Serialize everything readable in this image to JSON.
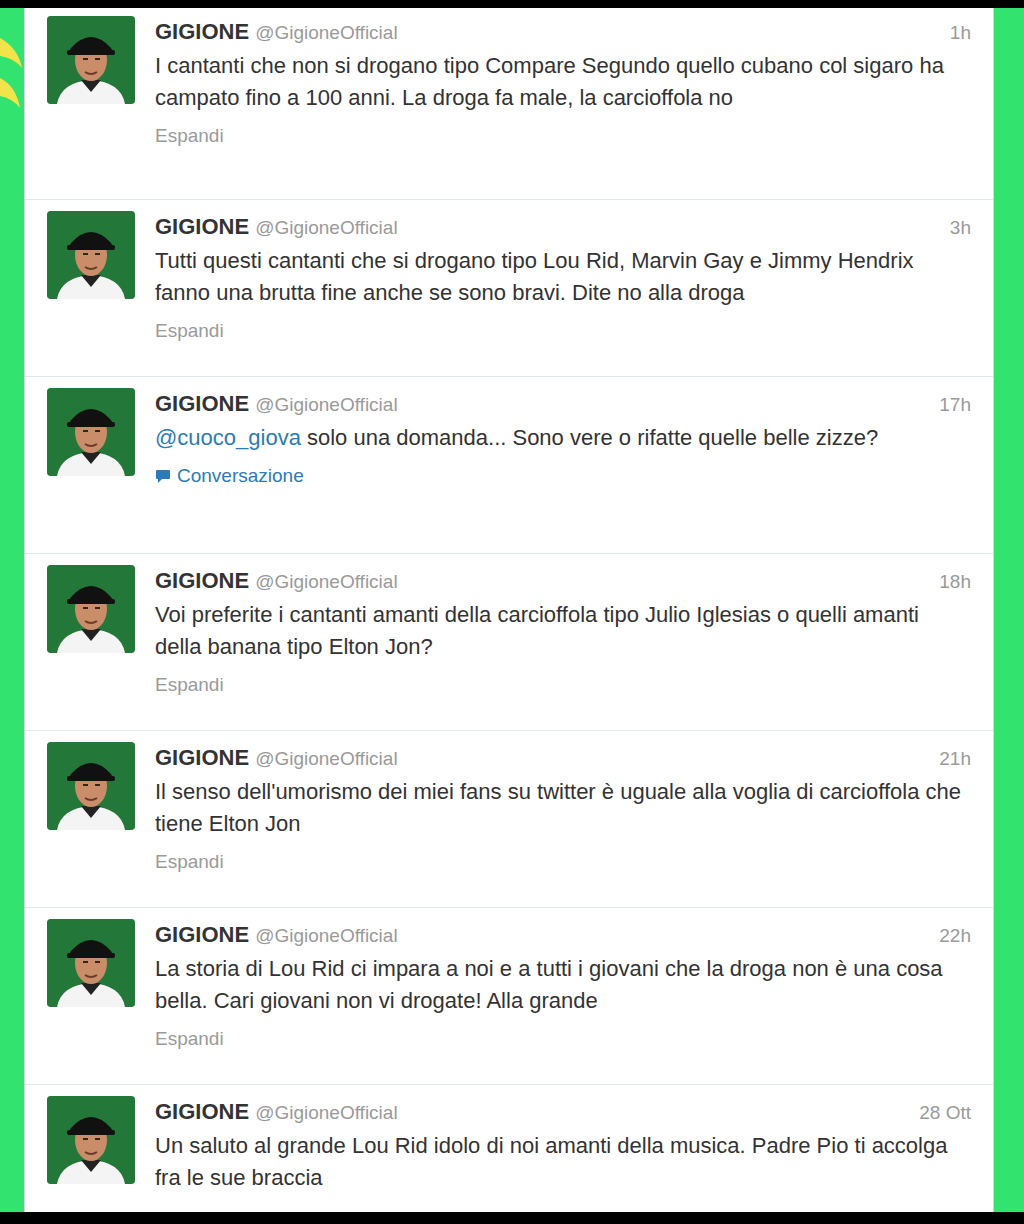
{
  "tweets": [
    {
      "name": "GIGIONE",
      "handle": "@GigioneOfficial",
      "time": "1h",
      "mention": "",
      "text": "I cantanti che non si drogano tipo Compare Segundo quello cubano col sigaro ha campato fino a 100 anni. La droga fa male, la carcioffola no",
      "action": {
        "kind": "expand",
        "label": "Espandi"
      }
    },
    {
      "name": "GIGIONE",
      "handle": "@GigioneOfficial",
      "time": "3h",
      "mention": "",
      "text": "Tutti questi cantanti che si drogano tipo Lou Rid, Marvin Gay e Jimmy Hendrix fanno una brutta fine anche se sono bravi. Dite no alla droga",
      "action": {
        "kind": "expand",
        "label": "Espandi"
      }
    },
    {
      "name": "GIGIONE",
      "handle": "@GigioneOfficial",
      "time": "17h",
      "mention": "@cuoco_giova",
      "text": " solo una domanda... Sono vere o rifatte quelle belle zizze?",
      "action": {
        "kind": "conversation",
        "label": "Conversazione"
      }
    },
    {
      "name": "GIGIONE",
      "handle": "@GigioneOfficial",
      "time": "18h",
      "mention": "",
      "text": "Voi preferite i cantanti amanti della carcioffola tipo Julio Iglesias o quelli amanti della banana tipo Elton Jon?",
      "action": {
        "kind": "expand",
        "label": "Espandi"
      }
    },
    {
      "name": "GIGIONE",
      "handle": "@GigioneOfficial",
      "time": "21h",
      "mention": "",
      "text": "Il senso dell'umorismo dei miei fans su twitter è uguale alla voglia di carcioffola che tiene Elton Jon",
      "action": {
        "kind": "expand",
        "label": "Espandi"
      }
    },
    {
      "name": "GIGIONE",
      "handle": "@GigioneOfficial",
      "time": "22h",
      "mention": "",
      "text": "La storia di Lou Rid ci impara a noi e a tutti i giovani che la droga non è una cosa bella. Cari giovani non vi drogate! Alla grande",
      "action": {
        "kind": "expand",
        "label": "Espandi"
      }
    },
    {
      "name": "GIGIONE",
      "handle": "@GigioneOfficial",
      "time": "28 Ott",
      "mention": "",
      "text": "Un saluto al grande Lou Rid idolo di noi amanti della musica. Padre Pio ti accolga fra le sue braccia",
      "action": null
    }
  ]
}
